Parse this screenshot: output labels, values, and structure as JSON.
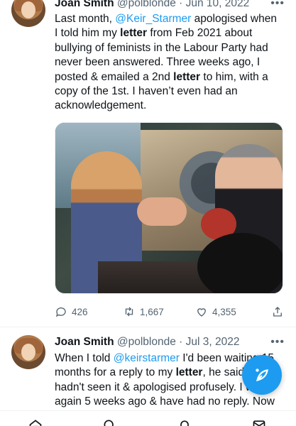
{
  "tweets": [
    {
      "name": "Joan Smith",
      "handle": "@polblonde",
      "dot": "·",
      "date": "Jun 10, 2022",
      "text_parts": {
        "p1": "Last month, ",
        "mention": "@Keir_Starmer",
        "p2": " apologised when I told him my ",
        "bold1": "letter",
        "p3": " from Feb 2021 about bullying of feminists in the Labour Party had never been answered. Three weeks ago, I posted & emailed a 2nd ",
        "bold2": "letter",
        "p4": " to him, with a copy of the 1st. I haven’t even had an acknowledgement."
      },
      "stats": {
        "replies": "426",
        "retweets": "1,667",
        "likes": "4,355"
      }
    },
    {
      "name": "Joan Smith",
      "handle": "@polblonde",
      "dot": "·",
      "date": "Jul 3, 2022",
      "text_parts": {
        "p1": "When I told ",
        "mention": "@keirstarmer",
        "p2": " I'd been waiting 15 months for a reply to my ",
        "bold1": "letter",
        "p3": ", he said he hadn't seen it & apologised profusely. I wrote again 5 weeks ago & have had no reply. Now"
      }
    }
  ],
  "icons": {
    "more": "more-icon",
    "reply": "reply-icon",
    "retweet": "retweet-icon",
    "like": "heart-icon",
    "share": "share-icon",
    "compose": "compose-tweet-icon",
    "nav": [
      "home-icon",
      "search-icon",
      "notifications-icon",
      "messages-icon"
    ]
  },
  "colors": {
    "accent": "#1d9bf0",
    "text": "#0f1419",
    "secondary": "#536471"
  }
}
